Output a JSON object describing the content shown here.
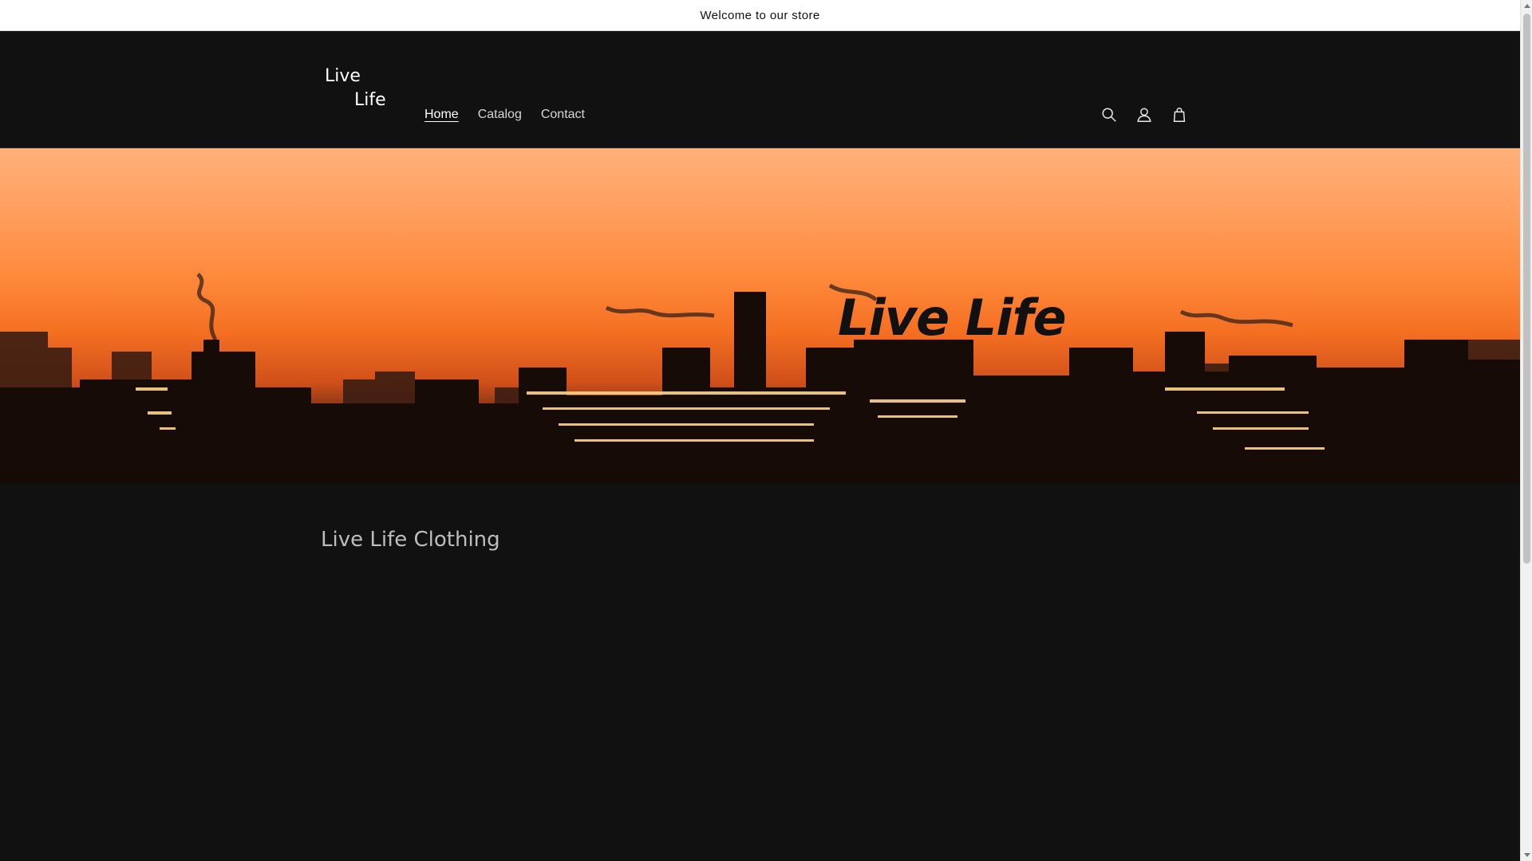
{
  "announcement": {
    "text": "Welcome to our store"
  },
  "header": {
    "logo_line1": "Live",
    "logo_line2": "Life",
    "nav": [
      {
        "label": "Home",
        "active": true
      },
      {
        "label": "Catalog",
        "active": false
      },
      {
        "label": "Contact",
        "active": false
      }
    ],
    "icons": [
      "search-icon",
      "account-icon",
      "cart-icon"
    ]
  },
  "hero": {
    "title": "Live Life"
  },
  "collection": {
    "title": "Live Life Clothing"
  },
  "colors": {
    "background": "#111111",
    "announcement_bg": "#ffffff",
    "sky_top": "#ffb07a",
    "sky_mid": "#f46f22",
    "hero_title": "#111111"
  }
}
